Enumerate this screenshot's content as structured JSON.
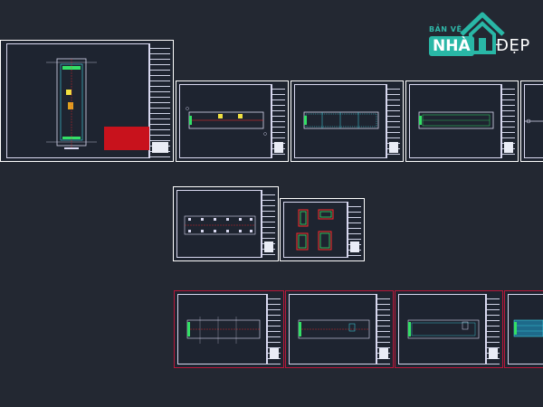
{
  "canvas": {
    "background": "#232832"
  },
  "logo": {
    "top_text": "BẢN VẼ",
    "highlight_text": "NHÀ",
    "suffix_text": "ĐẸP",
    "accent_color": "#29b7a6"
  },
  "colors": {
    "sheet_border": "#ffffff",
    "selected_sheet_border": "#b8173a",
    "cad_red": "#ff2a2a",
    "cad_green": "#33e066",
    "cad_cyan": "#40d8e8",
    "cad_yellow": "#f0e040"
  },
  "sheets": [
    {
      "id": "cover-site-plan"
    },
    {
      "id": "plan-1"
    },
    {
      "id": "plan-2"
    },
    {
      "id": "plan-3"
    },
    {
      "id": "plan-4"
    },
    {
      "id": "foundation-plan"
    },
    {
      "id": "details"
    },
    {
      "id": "elevation-1"
    },
    {
      "id": "elevation-2"
    },
    {
      "id": "elevation-3"
    },
    {
      "id": "elevation-4"
    }
  ]
}
